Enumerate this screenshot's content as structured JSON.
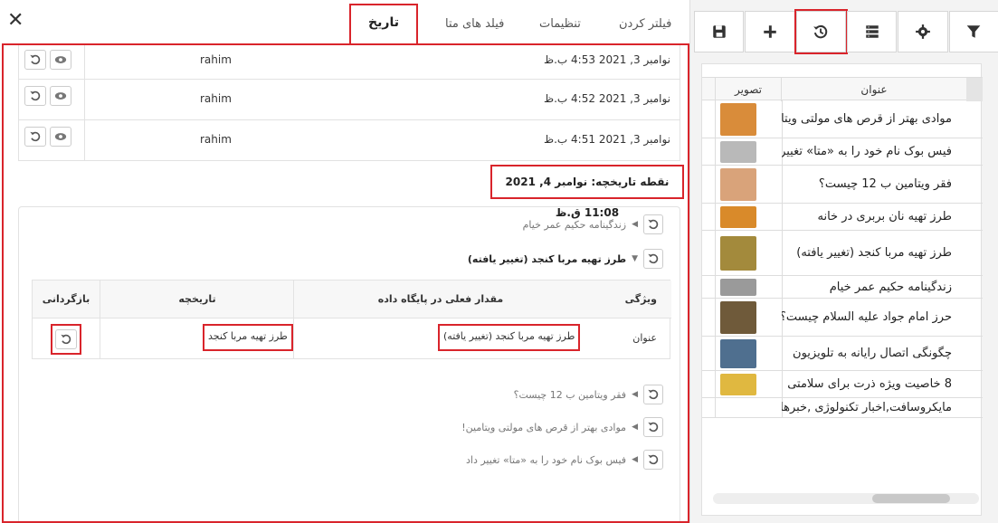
{
  "dialog": {
    "tabs": [
      "فیلتر کردن",
      "تنظیمات",
      "فیلد های متا"
    ],
    "active_tab": "تاریخ",
    "close_glyph": "✕"
  },
  "history": {
    "rows": [
      {
        "date": "نوامبر 3, 2021 4:53 ب.ظ",
        "user": "rahim"
      },
      {
        "date": "نوامبر 3, 2021 4:52 ب.ظ",
        "user": "rahim"
      },
      {
        "date": "نوامبر 3, 2021 4:51 ب.ظ",
        "user": "rahim"
      }
    ],
    "checkpoint_label": "نقطه تاریخچه: نوامبر 4, 2021 11:08 ق.ظ",
    "tree": {
      "item_top": "زندگینامه حکیم عمر خیام",
      "item_expanded": "طرز تهیه مربا کنجد (تغییر یافته)",
      "items_bottom": [
        "فقر ویتامین ب 12 چیست؟",
        "موادی بهتر از قرص های مولتی ویتامین!",
        "فیس بوک نام خود را به «متا» تغییر داد"
      ]
    },
    "table": {
      "headers": {
        "property": "ویژگی",
        "db_value": "مقدار فعلی در پایگاه داده",
        "history": "تاریخچه",
        "revert": "بازگردانی"
      },
      "row": {
        "property": "عنوان",
        "db_value": "طرز تهیه مربا کنجد (تغییر یافته)",
        "history": "طرز تهیه مربا کنجد"
      }
    }
  },
  "side": {
    "toolbar_icons": [
      "filter-icon",
      "gear-icon",
      "columns-icon",
      "history-icon",
      "plus-icon",
      "save-icon"
    ],
    "grid": {
      "headers": {
        "title": "عنوان",
        "image": "تصویر"
      },
      "rows": [
        {
          "title": "موادی بهتر از قرص های مولتی ویتامین!",
          "thumb": "#d98c3a"
        },
        {
          "title": "فیس بوک نام خود را به «متا» تغییر داد",
          "thumb": "#b9b9b9"
        },
        {
          "title": "فقر ویتامین ب 12 چیست؟",
          "thumb": "#d9a37a"
        },
        {
          "title": "طرز تهیه نان بربری در خانه",
          "thumb": "#d98a2a"
        },
        {
          "title": "طرز تهیه مربا کنجد (تغییر یافته)",
          "thumb": "#a38a3c"
        },
        {
          "title": "زندگینامه حکیم عمر خیام",
          "thumb": "#9a9a9a"
        },
        {
          "title": "حرز امام جواد علیه السلام چیست؟",
          "thumb": "#6f5a3a"
        },
        {
          "title": "چگونگی اتصال رایانه به تلویزیون",
          "thumb": "#4f6f8f"
        },
        {
          "title": "8 خاصیت ویژه ذرت برای سلامتی",
          "thumb": "#e0b840"
        },
        {
          "title": "مایکروسافت,اخبار تکنولوژی ,خبرهای",
          "thumb": ""
        }
      ]
    }
  }
}
